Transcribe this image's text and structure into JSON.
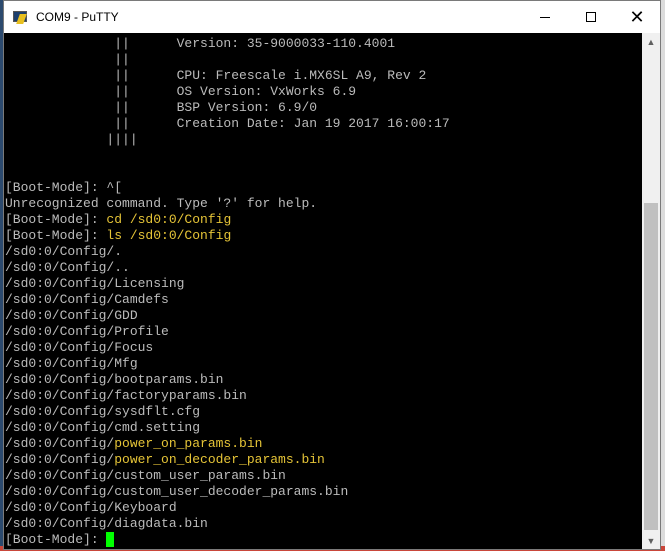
{
  "window": {
    "title": "COM9 - PuTTY",
    "minimize_symbol": "",
    "maximize_symbol": "",
    "close_symbol": "✕"
  },
  "terminal": {
    "lines": [
      {
        "text": "              ||      Version: 35-9000033-110.4001",
        "highlight": ""
      },
      {
        "text": "              ||",
        "highlight": ""
      },
      {
        "text": "              ||      CPU: Freescale i.MX6SL A9, Rev 2",
        "highlight": ""
      },
      {
        "text": "              ||      OS Version: VxWorks 6.9",
        "highlight": ""
      },
      {
        "text": "              ||      BSP Version: 6.9/0",
        "highlight": ""
      },
      {
        "text": "              ||      Creation Date: Jan 19 2017 16:00:17",
        "highlight": ""
      },
      {
        "text": "             ||||",
        "highlight": ""
      },
      {
        "text": "",
        "highlight": ""
      },
      {
        "text": "",
        "highlight": ""
      },
      {
        "text": "[Boot-Mode]: ^[",
        "highlight": ""
      },
      {
        "text": "Unrecognized command. Type '?' for help.",
        "highlight": ""
      },
      {
        "text": "[Boot-Mode]: ",
        "highlight": "cd /sd0:0/Config"
      },
      {
        "text": "[Boot-Mode]: ",
        "highlight": "ls /sd0:0/Config"
      },
      {
        "text": "/sd0:0/Config/.",
        "highlight": ""
      },
      {
        "text": "/sd0:0/Config/..",
        "highlight": ""
      },
      {
        "text": "/sd0:0/Config/Licensing",
        "highlight": ""
      },
      {
        "text": "/sd0:0/Config/Camdefs",
        "highlight": ""
      },
      {
        "text": "/sd0:0/Config/GDD",
        "highlight": ""
      },
      {
        "text": "/sd0:0/Config/Profile",
        "highlight": ""
      },
      {
        "text": "/sd0:0/Config/Focus",
        "highlight": ""
      },
      {
        "text": "/sd0:0/Config/Mfg",
        "highlight": ""
      },
      {
        "text": "/sd0:0/Config/bootparams.bin",
        "highlight": ""
      },
      {
        "text": "/sd0:0/Config/factoryparams.bin",
        "highlight": ""
      },
      {
        "text": "/sd0:0/Config/sysdflt.cfg",
        "highlight": ""
      },
      {
        "text": "/sd0:0/Config/cmd.setting",
        "highlight": ""
      },
      {
        "text": "/sd0:0/Config/",
        "highlight": "power_on_params.bin"
      },
      {
        "text": "/sd0:0/Config/",
        "highlight": "power_on_decoder_params.bin"
      },
      {
        "text": "/sd0:0/Config/custom_user_params.bin",
        "highlight": ""
      },
      {
        "text": "/sd0:0/Config/custom_user_decoder_params.bin",
        "highlight": ""
      },
      {
        "text": "/sd0:0/Config/Keyboard",
        "highlight": ""
      },
      {
        "text": "/sd0:0/Config/diagdata.bin",
        "highlight": ""
      }
    ],
    "prompt": "[Boot-Mode]: ",
    "highlight_color": "#e5c437",
    "cursor_color": "#00ff00"
  },
  "scrollbar": {
    "up_icon": "▲",
    "down_icon": "▼"
  }
}
